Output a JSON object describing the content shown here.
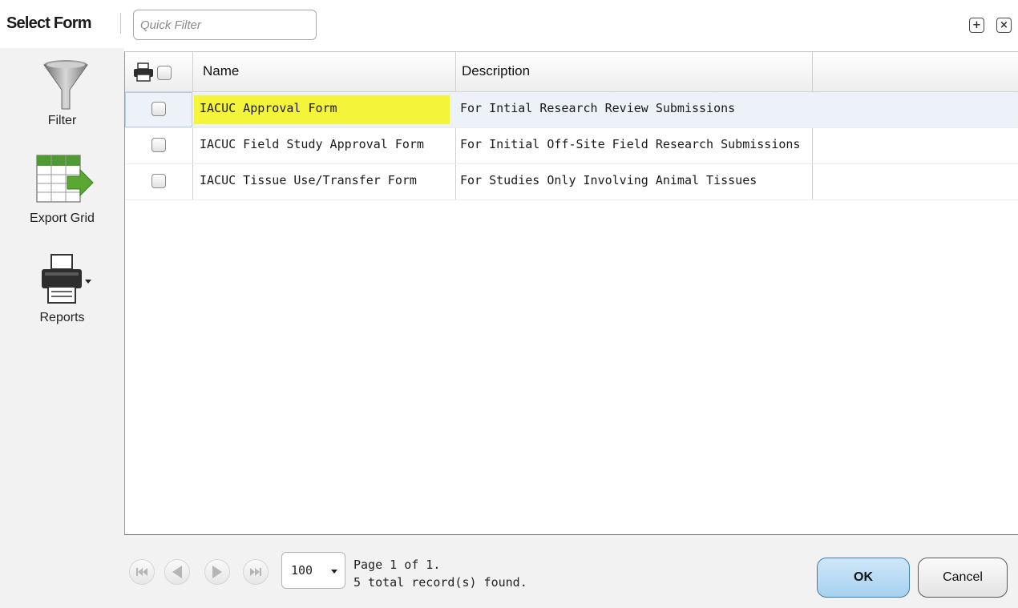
{
  "header": {
    "title": "Select Form",
    "quick_filter_placeholder": "Quick Filter",
    "expand_glyph": "+",
    "close_glyph": "×"
  },
  "toolbar": {
    "items": [
      {
        "label": "Filter",
        "icon": "funnel-icon"
      },
      {
        "label": "Export Grid",
        "icon": "export-grid-icon"
      },
      {
        "label": "Reports",
        "icon": "printer-icon"
      }
    ]
  },
  "grid": {
    "columns": [
      "Name",
      "Description"
    ],
    "rows": [
      {
        "name": "IACUC Approval Form",
        "description": "For Intial Research Review Submissions",
        "highlighted": true,
        "checked": false
      },
      {
        "name": "IACUC Field Study Approval Form",
        "description": "For Initial Off-Site Field Research Submissions",
        "highlighted": false,
        "checked": false
      },
      {
        "name": "IACUC Tissue Use/Transfer Form",
        "description": "For Studies Only Involving Animal Tissues",
        "highlighted": false,
        "checked": false
      }
    ]
  },
  "footer": {
    "page_size": "100",
    "page_text": "Page 1 of 1.",
    "records_text": "5 total record(s) found.",
    "ok_label": "OK",
    "cancel_label": "Cancel"
  },
  "colors": {
    "highlight": "#f4f43a",
    "ok_button": "#b8dcf5",
    "export_green": "#5aa832"
  }
}
